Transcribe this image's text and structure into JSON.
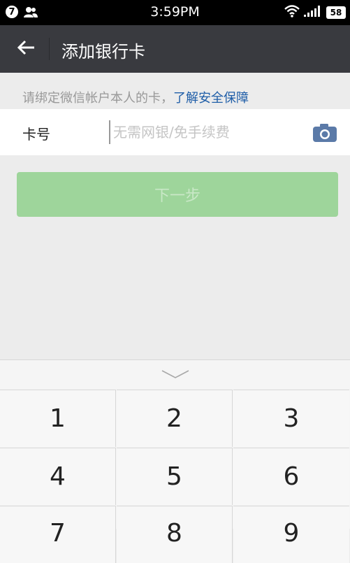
{
  "status_bar": {
    "notification_count": "7",
    "time": "3:59PM",
    "battery": "58"
  },
  "nav": {
    "title": "添加银行卡"
  },
  "hint": {
    "text": "请绑定微信帐户本人的卡，",
    "link": "了解安全保障"
  },
  "card_row": {
    "label": "卡号",
    "placeholder": "无需网银/免手续费",
    "value": ""
  },
  "next_button": {
    "label": "下一步"
  },
  "keyboard": {
    "keys": [
      "1",
      "2",
      "3",
      "4",
      "5",
      "6",
      "7",
      "8",
      "9"
    ]
  },
  "colors": {
    "nav_bg": "#393a3f",
    "accent_link": "#1f5ea8",
    "button_green_disabled": "#9ed59b",
    "camera_icon": "#5b7aa8"
  }
}
